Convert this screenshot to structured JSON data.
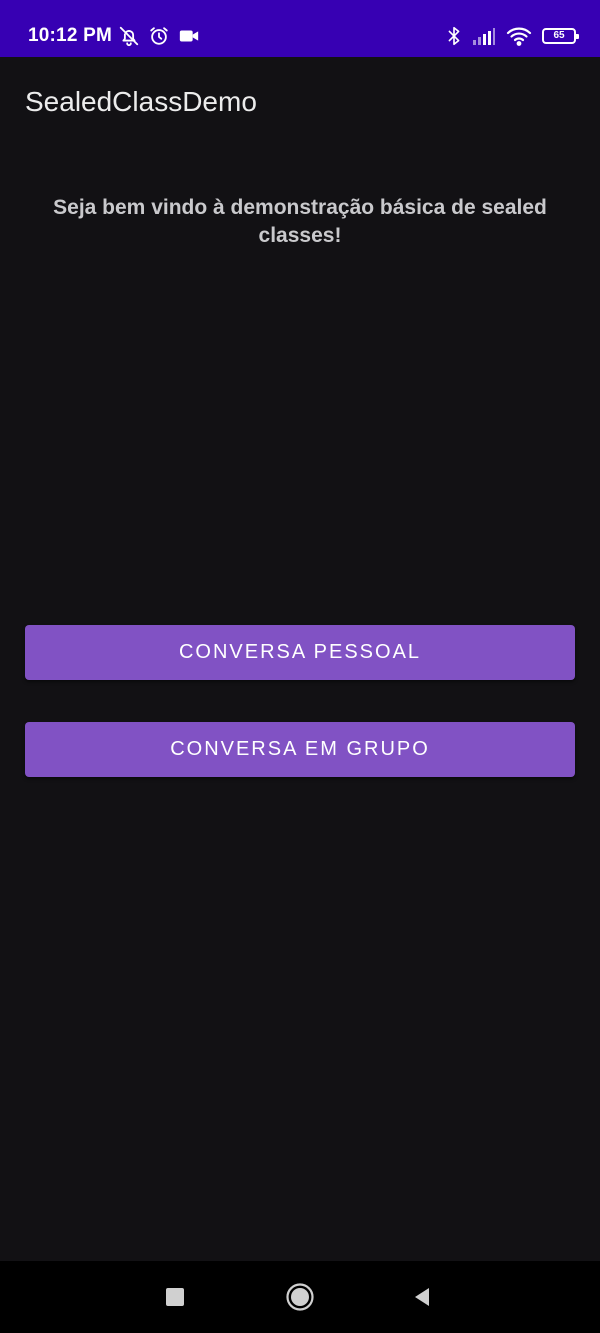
{
  "status_bar": {
    "time": "10:12 PM",
    "left_icons": [
      "notifications-off-icon",
      "alarm-icon",
      "video-camera-icon"
    ],
    "right_icons": [
      "bluetooth-icon",
      "signal-icon",
      "wifi-icon",
      "battery-icon"
    ],
    "battery_level": "65",
    "background_color": "#3700b3"
  },
  "app_bar": {
    "title": "SealedClassDemo"
  },
  "main": {
    "welcome_text": "Seja bem vindo à demonstração básica de sealed classes!",
    "buttons": [
      {
        "label": "CONVERSA PESSOAL"
      },
      {
        "label": "CONVERSA EM GRUPO"
      }
    ],
    "button_color": "#8152c4",
    "background_color": "#121114"
  },
  "nav_bar": {
    "items": [
      "recents-icon",
      "home-icon",
      "back-icon"
    ]
  }
}
